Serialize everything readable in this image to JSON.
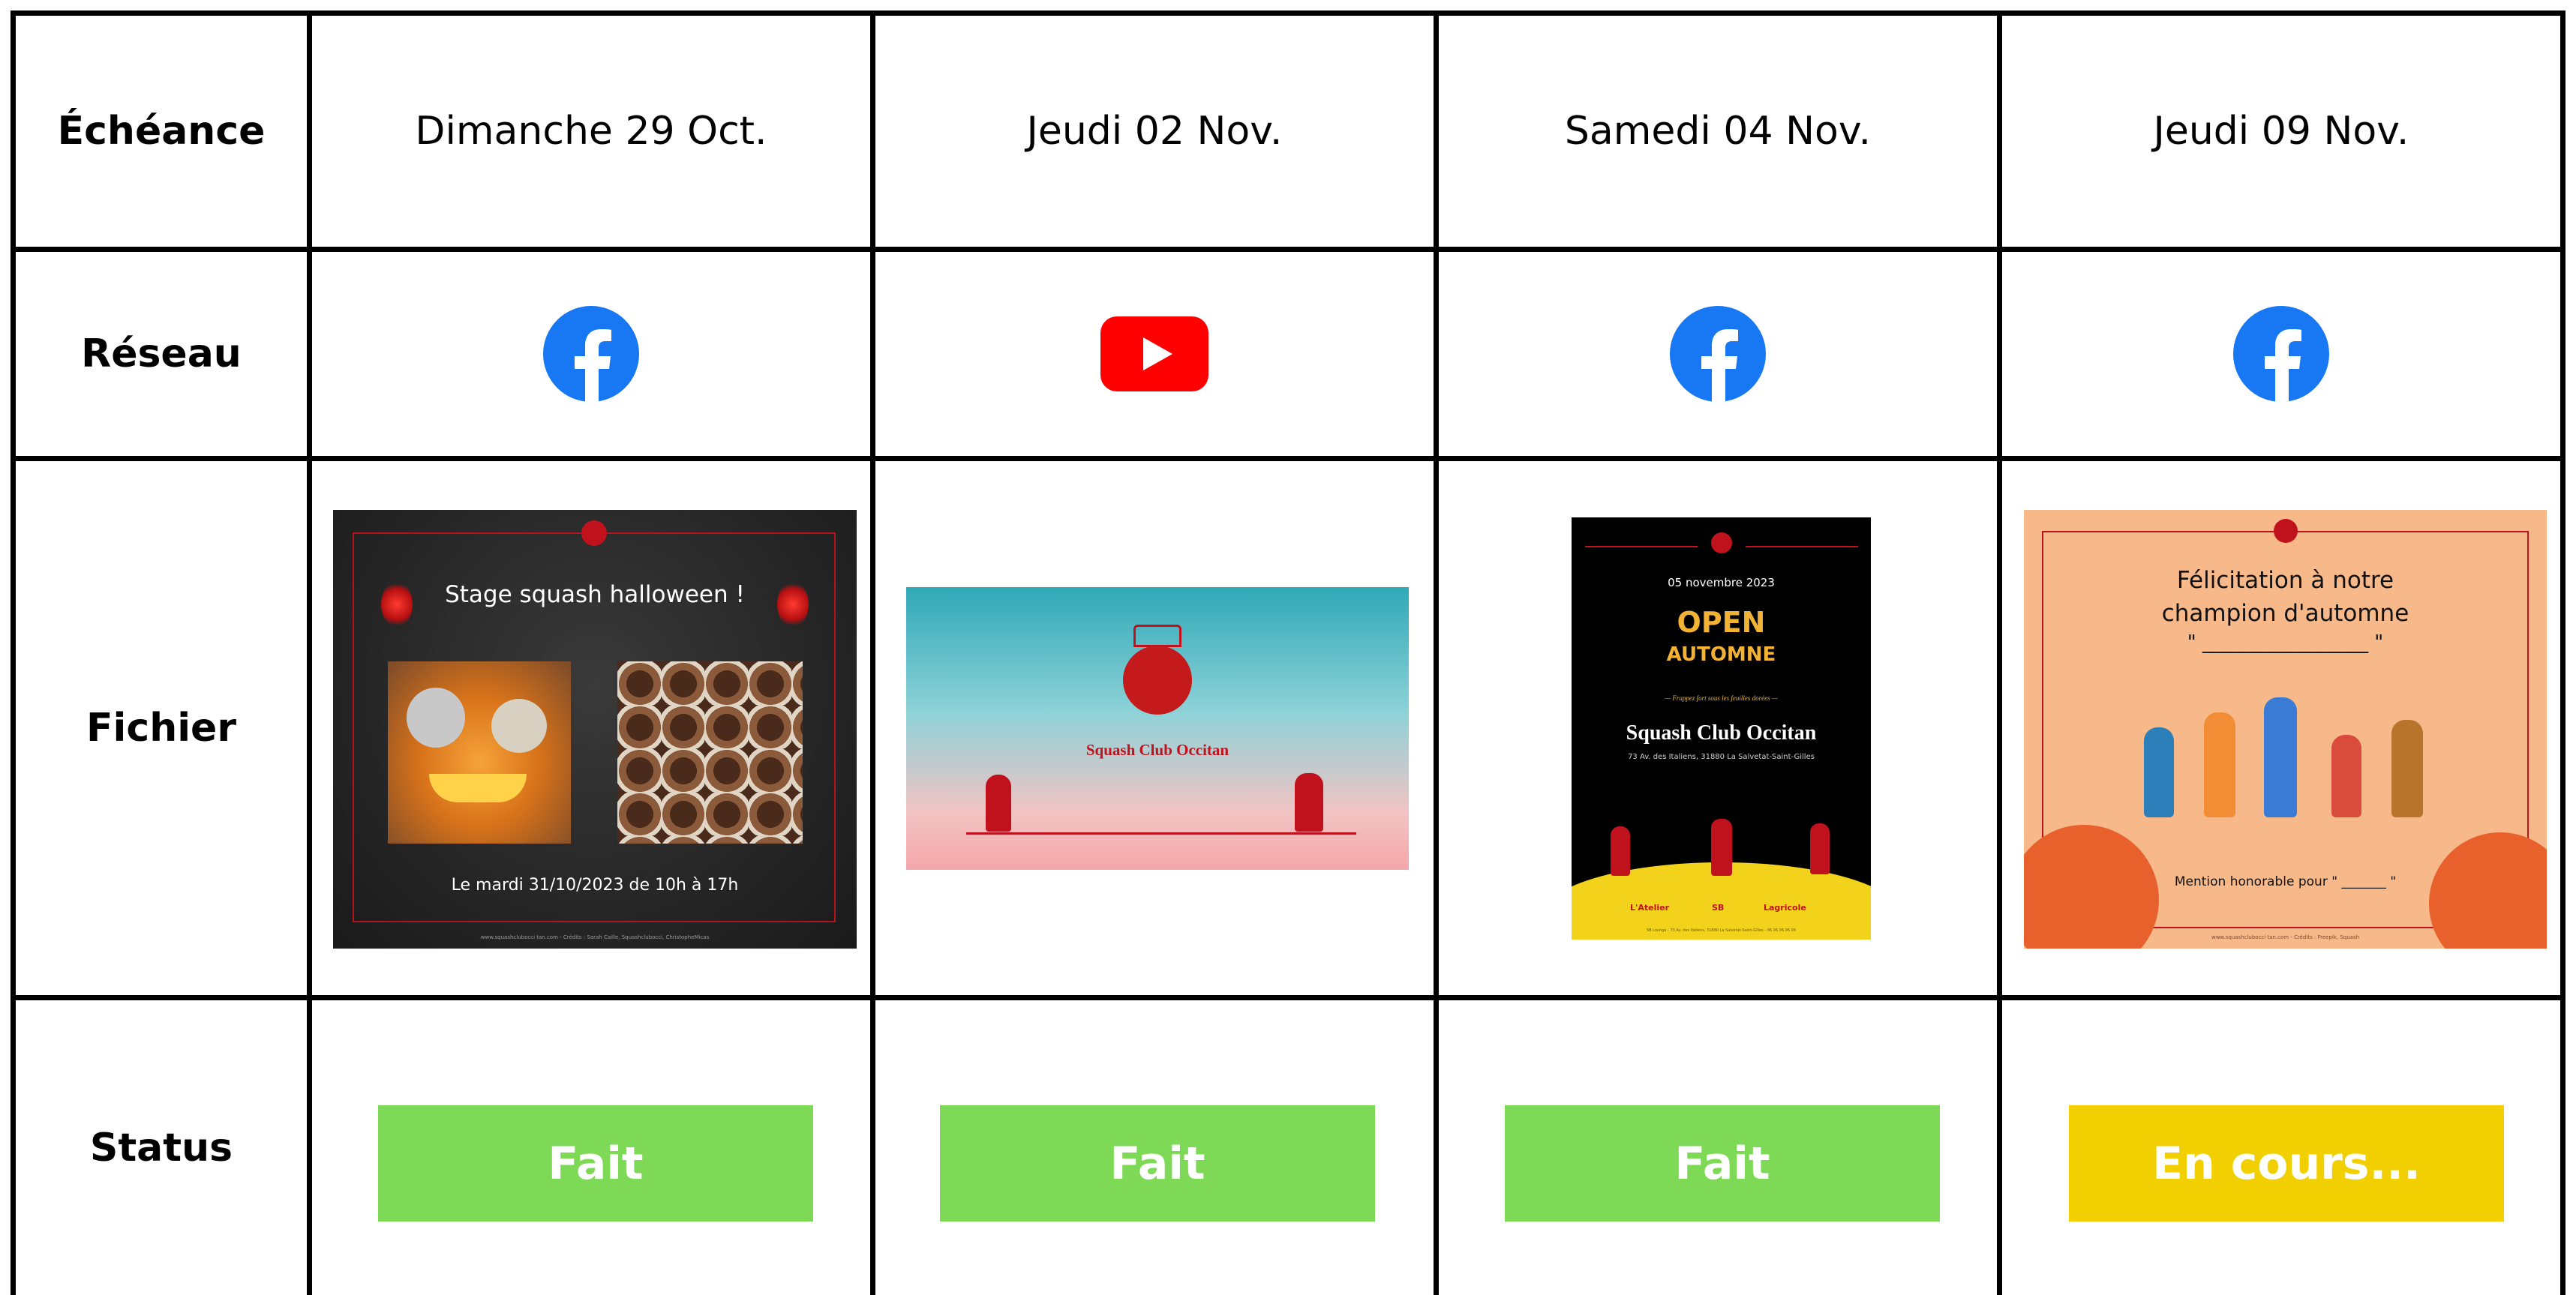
{
  "row_labels": {
    "deadline": "Échéance",
    "network": "Réseau",
    "file": "Fichier",
    "status": "Status"
  },
  "columns": [
    {
      "date": "Dimanche 29 Oct.",
      "network_icon": "facebook-icon",
      "status": "Fait",
      "status_color": "#7ed957",
      "file": {
        "title": "Stage squash halloween !",
        "subtitle": "Le mardi 31/10/2023 de 10h à 17h",
        "footer": "www.squashclubocci tan.com - Crédits : Sarah Caille, Squashclubocci, ChristopheMicas"
      }
    },
    {
      "date": "Jeudi 02 Nov.",
      "network_icon": "youtube-icon",
      "status": "Fait",
      "status_color": "#7ed957",
      "file": {
        "title": "Squash Club Occitan"
      }
    },
    {
      "date": "Samedi 04 Nov.",
      "network_icon": "facebook-icon",
      "status": "Fait",
      "status_color": "#7ed957",
      "file": {
        "date_line": "05 novembre 2023",
        "headline_1": "OPEN",
        "headline_2": "AUTOMNE",
        "tagline": "— Frappez fort sous les feuilles dorées —",
        "club": "Squash Club Occitan",
        "address": "73 Av. des Italiens, 31880 La Salvetat-Saint-Gilles",
        "sponsor_1": "L'Atelier",
        "sponsor_2": "SB",
        "sponsor_3": "Lagricole",
        "footer": "SB Lounge - 73 Av. des Italiens, 31880 La Salvetat-Saint-Gilles - 06 06 06 06 06"
      }
    },
    {
      "date": "Jeudi 09 Nov.",
      "network_icon": "facebook-icon",
      "status": "En cours...",
      "status_color": "#f1cf00",
      "file": {
        "title_1": "Félicitation à notre",
        "title_2": "champion d'automne",
        "blank": "\" _________________ \"",
        "mention": "Mention honorable pour \" _______ \"",
        "footer": "www.squashclubocci tan.com - Crédits : Freepik, Squash"
      }
    }
  ],
  "colors": {
    "grid": "#000000",
    "facebook": "#1877f2",
    "youtube": "#ff0000",
    "club_red": "#c0121c",
    "done": "#7ed957",
    "in_progress": "#f1cf00"
  }
}
